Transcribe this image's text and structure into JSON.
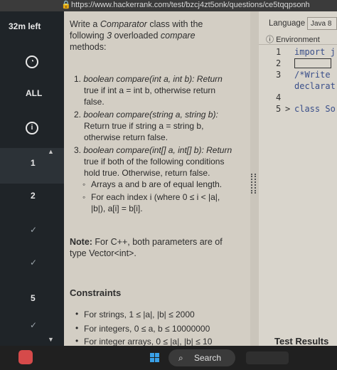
{
  "browser": {
    "url": "https://www.hackerrank.com/test/bzcj4zt5onk/questions/ce5tqqpsonh"
  },
  "nav": {
    "timer": "32m left",
    "all_label": "ALL",
    "questions": [
      "1",
      "2",
      "5"
    ],
    "info_icon": "i"
  },
  "question": {
    "intro_1": "Write a ",
    "intro_class": "Comparator",
    "intro_2": " class with the",
    "intro_line2a": "following ",
    "intro_line2b": "3",
    "intro_line2c": " overloaded ",
    "intro_line2d": "compare",
    "intro_line3": "methods:",
    "items": [
      {
        "num": "1.",
        "l1": "boolean compare(int a, int b): Return",
        "l2": "true if int a = int b, otherwise return",
        "l3": "false."
      },
      {
        "num": "2.",
        "l1": "boolean compare(string a, string b):",
        "l2": "Return true if string a = string b,",
        "l3": "otherwise return false."
      },
      {
        "num": "3.",
        "l1": "boolean compare(int[] a, int[] b): Return",
        "l2": "true if both of the following conditions",
        "l3": "hold true. Otherwise, return false."
      }
    ],
    "sub_items": [
      {
        "l1": "Arrays a and b are of equal length."
      },
      {
        "l1": "For each index i (where 0 ≤ i < |a|,",
        "l2": "|b|), a[i] = b[i]."
      }
    ],
    "note_label": "Note:",
    "note_text": " For C++, both parameters are of",
    "note_line2": "type Vector<int>.",
    "constraints_title": "Constraints",
    "constraints": [
      "For strings, 1 ≤ |a|, |b| ≤ 2000",
      "For integers, 0 ≤ a, b ≤ 10000000",
      "For integer arrays, 0 ≤ |a|, |b| ≤ 10"
    ]
  },
  "editor": {
    "language_label": "Language",
    "language_value": "Java 8",
    "environment_label": "Environment",
    "lines": [
      {
        "n": "1",
        "code": "import j"
      },
      {
        "n": "2",
        "code": ""
      },
      {
        "n": "3",
        "code": "/*Write"
      },
      {
        "n": "",
        "code": "declarat"
      },
      {
        "n": "4",
        "code": ""
      },
      {
        "n": "5",
        "code": "class So"
      }
    ],
    "fold_arrow": ">",
    "test_results": "Test Results"
  },
  "taskbar": {
    "search_label": "Search"
  },
  "colors": {
    "nav_bg": "#1f2428",
    "panel_bg": "#d3cec4",
    "code_color": "#3a4f8a"
  }
}
